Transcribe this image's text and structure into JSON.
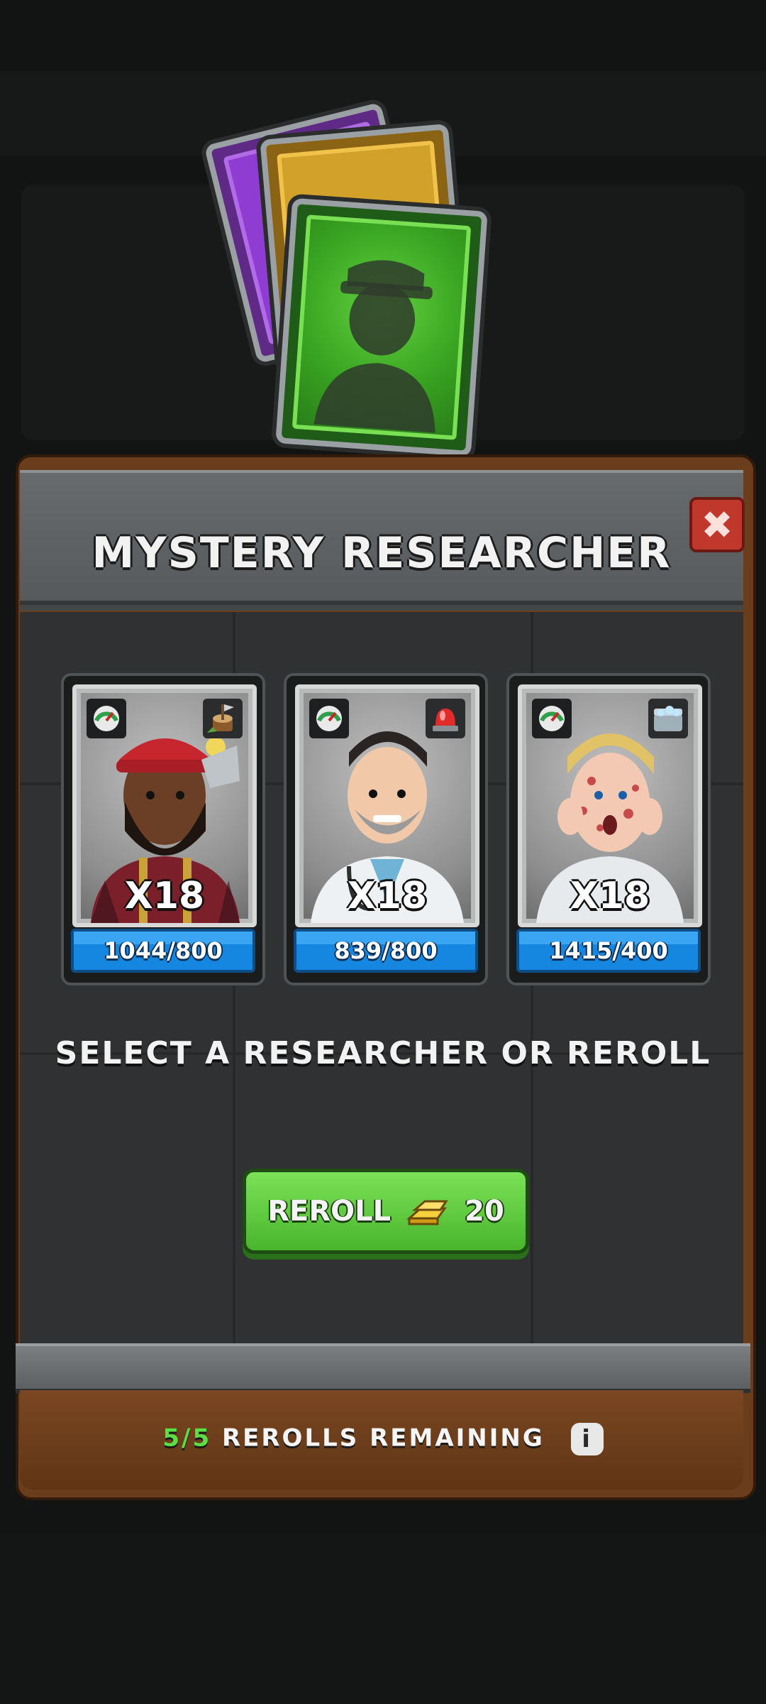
{
  "modal": {
    "title": "MYSTERY RESEARCHER",
    "close_label": "✖",
    "prompt": "SELECT A RESEARCHER OR REROLL",
    "reroll": {
      "label": "REROLL",
      "cost": "20",
      "currency_icon": "gold-bar-icon"
    },
    "rerolls_remaining": {
      "count": "5/5",
      "label": "REROLLS REMAINING",
      "info_label": "i"
    }
  },
  "researchers": [
    {
      "name": "lumberjack",
      "multiplier": "X18",
      "progress_text": "1044/800",
      "progress_fraction": 1.0,
      "skill_icon": "tree-stump-axe-icon"
    },
    {
      "name": "doctor",
      "multiplier": "X18",
      "progress_text": "839/800",
      "progress_fraction": 1.0,
      "skill_icon": "alarm-siren-icon"
    },
    {
      "name": "patient",
      "multiplier": "X18",
      "progress_text": "1415/400",
      "progress_fraction": 1.0,
      "skill_icon": "ice-chest-icon"
    }
  ],
  "colors": {
    "progress_blue": "#1687e0",
    "reroll_green": "#58e045",
    "close_red": "#c0382c",
    "card_purple": "#8f3cd2",
    "card_gold": "#d2a12a",
    "card_green": "#39a522"
  }
}
